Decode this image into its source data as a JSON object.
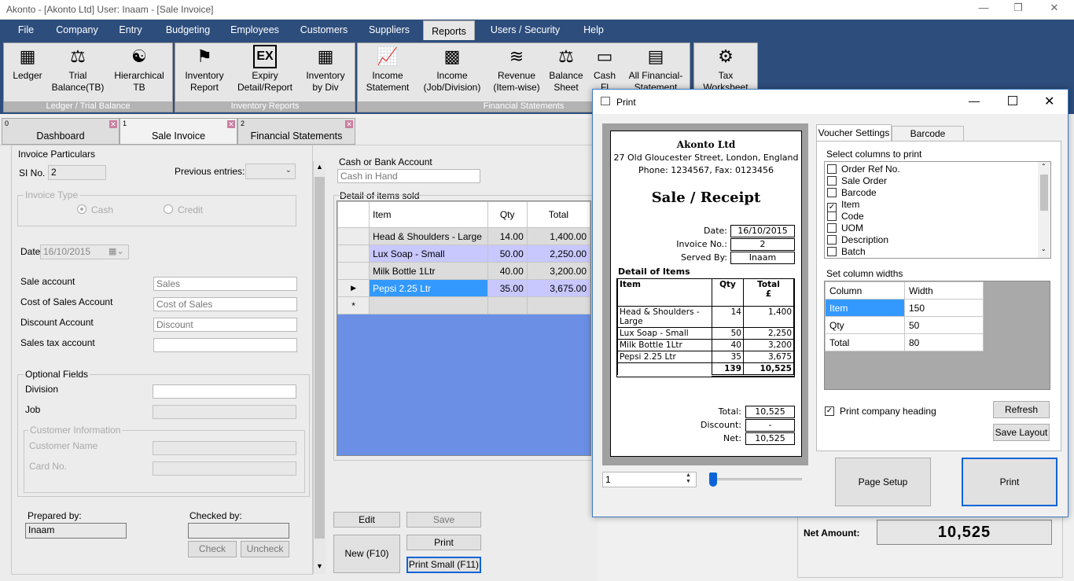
{
  "window": {
    "title": "Akonto - [Akonto Ltd]  User: Inaam - [Sale Invoice]"
  },
  "menu": [
    "File",
    "Company",
    "Entry",
    "Budgeting",
    "Employees",
    "Customers",
    "Suppliers",
    "Reports",
    "Users / Security",
    "Help"
  ],
  "ribbon": {
    "groups": {
      "ledger": "Ledger / Trial Balance",
      "inventory": "Inventory Reports",
      "financial": "Financial Statements"
    },
    "buttons": {
      "ledger": "Ledger",
      "trial": "Trial\nBalance(TB)",
      "hier": "Hierarchical\nTB",
      "invrep": "Inventory\nReport",
      "expiry": "Expiry\nDetail/Report",
      "invdiv": "Inventory\nby Div",
      "income": "Income\nStatement",
      "incomejob": "Income\n(Job/Division)",
      "revenue": "Revenue\n(Item-wise)",
      "balance": "Balance\nSheet",
      "cash": "Cash\nFl",
      "allfin": "All Financial-\nStatement",
      "tax": "Tax\nWorksheet"
    },
    "icons": {
      "ledger": "abacus-icon",
      "trial": "scales-icon",
      "hier": "hierarchy-icon",
      "invrep": "hand-truck-icon",
      "expiry": "ex-icon",
      "invdiv": "grid-icon",
      "income": "chart-up-icon",
      "incomejob": "bar-chart-icon",
      "revenue": "line-chart-icon",
      "balance": "balance-sheet-icon",
      "cash": "cash-icon",
      "allfin": "documents-icon",
      "tax": "tax-icon"
    }
  },
  "tabs": [
    {
      "num": "0",
      "label": "Dashboard"
    },
    {
      "num": "1",
      "label": "Sale Invoice"
    },
    {
      "num": "2",
      "label": "Financial Statements"
    }
  ],
  "form": {
    "particulars": "Invoice Particulars",
    "si_label": "SI No.",
    "si_value": "2",
    "prev_label": "Previous entries:",
    "type_label": "Invoice Type",
    "type_cash": "Cash",
    "type_credit": "Credit",
    "date_label": "Date",
    "date_value": "16/10/2015",
    "sale_account": "Sale account",
    "sale_account_value": "Sales",
    "cos_account": "Cost of Sales Account",
    "cos_account_value": "Cost of Sales",
    "discount_account": "Discount Account",
    "discount_account_value": "Discount",
    "tax_account": "Sales tax account",
    "optional": "Optional Fields",
    "division": "Division",
    "job": "Job",
    "cust_info": "Customer Information",
    "cust_name": "Customer Name",
    "card_no": "Card No.",
    "prepared_by": "Prepared by:",
    "prepared_value": "Inaam",
    "checked_by": "Checked by:",
    "check": "Check",
    "uncheck": "Uncheck",
    "cash_bank": "Cash or Bank Account",
    "cash_bank_value": "Cash in Hand",
    "detail_items": "Detail of items sold"
  },
  "items": {
    "headers": [
      "Item",
      "Qty",
      "Total"
    ],
    "rows": [
      {
        "item": "Head & Shoulders - Large",
        "qty": "14.00",
        "total": "1,400.00"
      },
      {
        "item": "Lux Soap - Small",
        "qty": "50.00",
        "total": "2,250.00"
      },
      {
        "item": "Milk Bottle 1Ltr",
        "qty": "40.00",
        "total": "3,200.00"
      },
      {
        "item": "Pepsi 2.25 Ltr",
        "qty": "35.00",
        "total": "3,675.00"
      }
    ]
  },
  "actions": {
    "edit": "Edit",
    "save": "Save",
    "print": "Print",
    "new": "New (F10)",
    "print_small": "Print Small (F11)"
  },
  "net_amount": {
    "label": "Net Amount:",
    "value": "10,525"
  },
  "print_dialog": {
    "title": "Print",
    "receipt": {
      "company": "Akonto Ltd",
      "address": "27 Old Gloucester Street, London, England",
      "phone": "Phone: 1234567, Fax: 0123456",
      "heading": "Sale / Receipt",
      "date_label": "Date:",
      "date": "16/10/2015",
      "invoice_label": "Invoice No.:",
      "invoice": "2",
      "served_label": "Served By:",
      "served": "Inaam",
      "detail_label": "Detail of Items",
      "col_item": "Item",
      "col_qty": "Qty",
      "col_total": "Total",
      "col_currency": "£",
      "rows": [
        {
          "item": "Head & Shoulders - Large",
          "qty": "14",
          "total": "1,400"
        },
        {
          "item": "Lux Soap - Small",
          "qty": "50",
          "total": "2,250"
        },
        {
          "item": "Milk Bottle 1Ltr",
          "qty": "40",
          "total": "3,200"
        },
        {
          "item": "Pepsi 2.25 Ltr",
          "qty": "35",
          "total": "3,675"
        }
      ],
      "sum_qty": "139",
      "sum_total": "10,525",
      "total_label": "Total:",
      "total": "10,525",
      "discount_label": "Discount:",
      "discount": "-",
      "net_label": "Net:",
      "net": "10,525"
    },
    "copies": "1",
    "tab_voucher": "Voucher Settings",
    "tab_barcode": "Barcode Settings",
    "select_columns": "Select columns to print",
    "columns": [
      {
        "label": "Order Ref No.",
        "checked": false
      },
      {
        "label": "Sale Order",
        "checked": false
      },
      {
        "label": "Barcode",
        "checked": false
      },
      {
        "label": "Item",
        "checked": true
      },
      {
        "label": "Code",
        "checked": false
      },
      {
        "label": "UOM",
        "checked": false
      },
      {
        "label": "Description",
        "checked": false
      },
      {
        "label": "Batch",
        "checked": false
      }
    ],
    "set_widths": "Set column widths",
    "width_headers": [
      "Column",
      "Width"
    ],
    "widths": [
      {
        "column": "Item",
        "width": "150"
      },
      {
        "column": "Qty",
        "width": "50"
      },
      {
        "column": "Total",
        "width": "80"
      }
    ],
    "print_heading": "Print company heading",
    "refresh": "Refresh",
    "save_layout": "Save Layout",
    "page_setup": "Page Setup",
    "print": "Print"
  }
}
